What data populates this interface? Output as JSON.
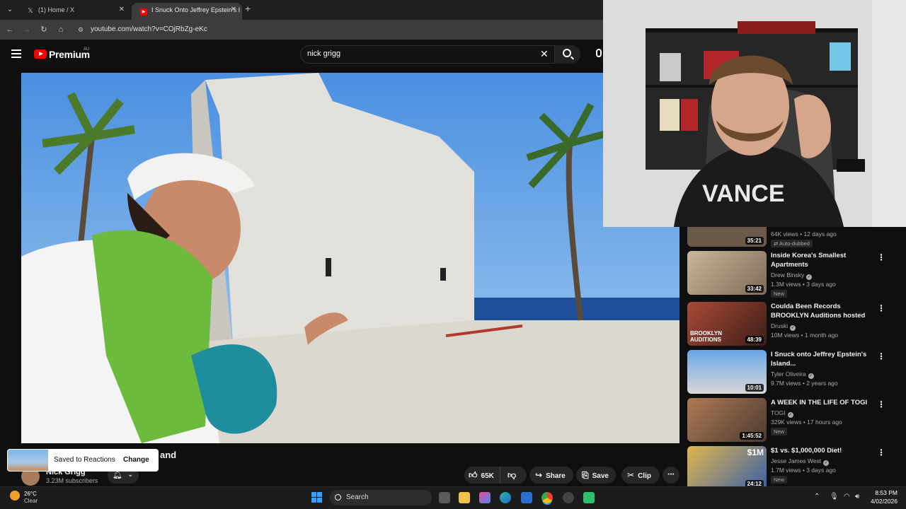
{
  "browser": {
    "tabs": [
      {
        "label": "(1) Home / X",
        "favicon": "x-logo-icon",
        "active": false
      },
      {
        "label": "I Snuck Onto Jeffrey Epstein's I",
        "favicon": "youtube-icon",
        "active": true
      }
    ],
    "new_tab": "+",
    "url": "youtube.com/watch?v=COjRbZg-eKc"
  },
  "youtube": {
    "logo_text": "Premium",
    "country": "AU",
    "search_query": "nick grigg",
    "video": {
      "title_visible": "and",
      "channel": "Nick Grigg",
      "subscribers": "3.23M subscribers",
      "likes": "65K",
      "share": "Share",
      "save": "Save",
      "clip": "Clip"
    },
    "toast": {
      "text": "Saved to Reactions",
      "action": "Change"
    },
    "recommendations": [
      {
        "title": "",
        "channel": "",
        "meta": "64K views • 12 days ago",
        "duration": "35:21",
        "badge": "Auto-dubbed",
        "thumb_color": "#6b5a4a"
      },
      {
        "title": "Inside Korea's Smallest Apartments",
        "channel": "Drew Binsky",
        "verified": true,
        "meta": "1.3M views • 3 days ago",
        "duration": "33:42",
        "badge": "New",
        "thumb_color": "#b9a58a"
      },
      {
        "title": "Coulda Been Records BROOKLYN Auditions hosted b...",
        "channel": "Druski",
        "verified": true,
        "meta": "10M views • 1 month ago",
        "duration": "48:39",
        "badge": "",
        "thumb_color": "#8a3b2b",
        "thumb_text": "BROOKLYN AUDITIONS"
      },
      {
        "title": "I Snuck onto Jeffrey Epstein's Island...",
        "channel": "Tyler Oliveira",
        "verified": true,
        "meta": "9.7M views • 2 years ago",
        "duration": "10:01",
        "badge": "",
        "thumb_color": "#5c8fd0"
      },
      {
        "title": "A WEEK IN THE LIFE OF TOGI",
        "channel": "TOGI",
        "verified": true,
        "meta": "329K views • 17 hours ago",
        "duration": "1:45:52",
        "badge": "New",
        "thumb_color": "#9a6b4b"
      },
      {
        "title": "$1 vs. $1,000,000 Diet!",
        "channel": "Jesse James West",
        "verified": true,
        "meta": "1.7M views • 3 days ago",
        "duration": "24:12",
        "badge": "New",
        "thumb_color": "#c9a23a",
        "thumb_text": "$1M"
      }
    ]
  },
  "taskbar": {
    "weather_temp": "26°C",
    "weather_desc": "Clear",
    "search_label": "Search",
    "time": "8:53 PM",
    "date": "4/02/2026"
  },
  "colors": {
    "youtube_red": "#ff0000",
    "background": "#0f0f0f",
    "windows_blue": "#3aa0f3"
  }
}
